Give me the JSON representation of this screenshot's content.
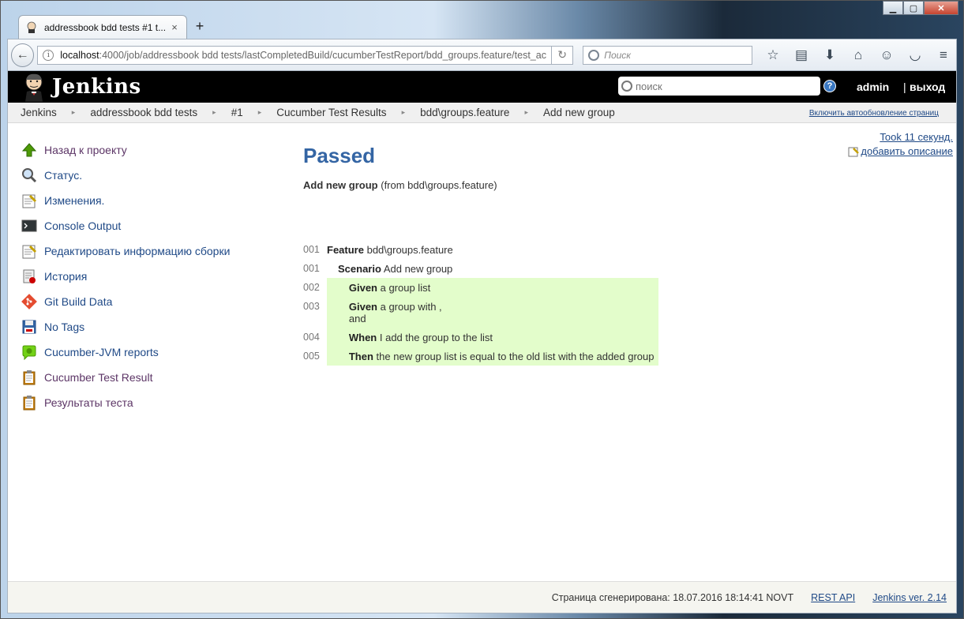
{
  "browser": {
    "tab_title": "addressbook bdd tests #1 t...",
    "tab_close": "×",
    "new_tab": "+",
    "url_host": "localhost",
    "url_path": ":4000/job/addressbook bdd tests/lastCompletedBuild/cucumberTestReport/bdd_groups.feature/test_ac",
    "search_placeholder": "Поиск"
  },
  "header": {
    "title": "Jenkins",
    "search_placeholder": "поиск",
    "help": "?",
    "user": "admin",
    "separator": "|",
    "logout": "выход"
  },
  "breadcrumbs": {
    "items": [
      "Jenkins",
      "addressbook bdd tests",
      "#1",
      "Cucumber Test Results",
      "bdd\\groups.feature",
      "Add new group"
    ],
    "auto_refresh": "Включить автообновление страниц"
  },
  "sidebar": {
    "items": [
      {
        "label": "Назад к проекту",
        "icon": "up-arrow-icon"
      },
      {
        "label": "Статус.",
        "icon": "magnifier-icon"
      },
      {
        "label": "Изменения.",
        "icon": "notepad-icon"
      },
      {
        "label": "Console Output",
        "icon": "terminal-icon"
      },
      {
        "label": "Редактировать информацию сборки",
        "icon": "notepad-icon"
      },
      {
        "label": "История",
        "icon": "history-icon"
      },
      {
        "label": "Git Build Data",
        "icon": "git-icon"
      },
      {
        "label": "No Tags",
        "icon": "floppy-icon"
      },
      {
        "label": "Cucumber-JVM reports",
        "icon": "cucumber-icon"
      },
      {
        "label": "Cucumber Test Result",
        "icon": "clipboard-icon"
      },
      {
        "label": "Результаты теста",
        "icon": "clipboard-icon"
      }
    ]
  },
  "main": {
    "status": "Passed",
    "test_name": "Add new group",
    "test_from": "(from bdd\\groups.feature)",
    "took": "Took 11 секунд.",
    "add_description": "добавить описание"
  },
  "steps": {
    "feature": {
      "num": "001",
      "keyword": "Feature",
      "text": "bdd\\groups.feature"
    },
    "scenario": {
      "num": "001",
      "keyword": "Scenario",
      "text": "Add new group"
    },
    "lines": [
      {
        "num": "002",
        "keyword": "Given",
        "text": "a group list",
        "extra": ""
      },
      {
        "num": "003",
        "keyword": "Given",
        "text": "a group with ,",
        "extra": "and"
      },
      {
        "num": "004",
        "keyword": "When",
        "text": "I add the group to the list",
        "extra": ""
      },
      {
        "num": "005",
        "keyword": "Then",
        "text": "the new group list is equal to the old list with the added group",
        "extra": ""
      }
    ]
  },
  "footer": {
    "generated": "Страница сгенерирована: 18.07.2016 18:14:41 NOVT",
    "rest_api": "REST API",
    "version": "Jenkins ver. 2.14"
  },
  "colors": {
    "passed_bg": "#e3fdcb",
    "status_blue": "#3465a4",
    "link": "#204a87"
  }
}
